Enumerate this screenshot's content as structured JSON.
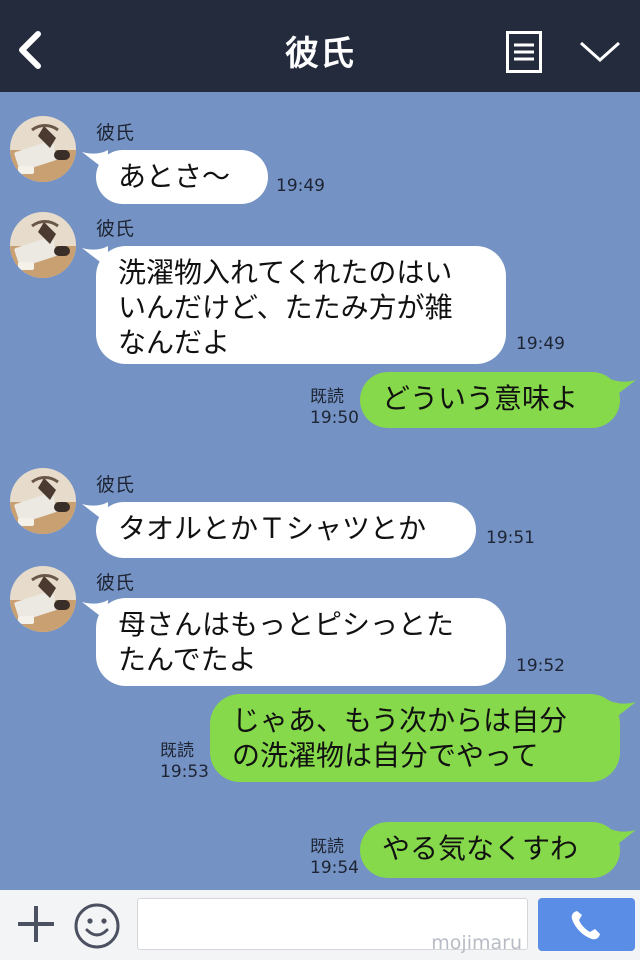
{
  "header": {
    "title": "彼氏",
    "icons": [
      "back-chevron-icon",
      "menu-list-icon",
      "chevron-down-icon"
    ]
  },
  "messages": [
    {
      "side": "in",
      "sender": "彼氏",
      "text": "あとさ〜",
      "time": "19:49"
    },
    {
      "side": "in",
      "sender": "彼氏",
      "lines": [
        "洗濯物入れてくれたのはい",
        "いんだけど、たたみ方が雑",
        "なんだよ"
      ],
      "time": "19:49"
    },
    {
      "side": "out",
      "read": "既読",
      "text": "どういう意味よ",
      "time": "19:50"
    },
    {
      "side": "in",
      "sender": "彼氏",
      "text": "タオルとかＴシャツとか",
      "time": "19:51"
    },
    {
      "side": "in",
      "sender": "彼氏",
      "lines": [
        "母さんはもっとピシっとた",
        "たんでたよ"
      ],
      "time": "19:52"
    },
    {
      "side": "out",
      "read": "既読",
      "lines": [
        "じゃあ、もう次からは自分",
        "の洗濯物は自分でやって"
      ],
      "time": "19:53"
    },
    {
      "side": "out",
      "read": "既読",
      "text": "やる気なくすわ",
      "time": "19:54"
    }
  ],
  "composer": {
    "input_value": "",
    "watermark": "mojimaru",
    "icons": [
      "plus-icon",
      "emoji-icon",
      "phone-icon"
    ]
  },
  "colors": {
    "background": "#7493c4",
    "header": "#232b3d",
    "incoming": "#ffffff",
    "outgoing": "#86d94a",
    "call_button": "#5a8ee6"
  }
}
